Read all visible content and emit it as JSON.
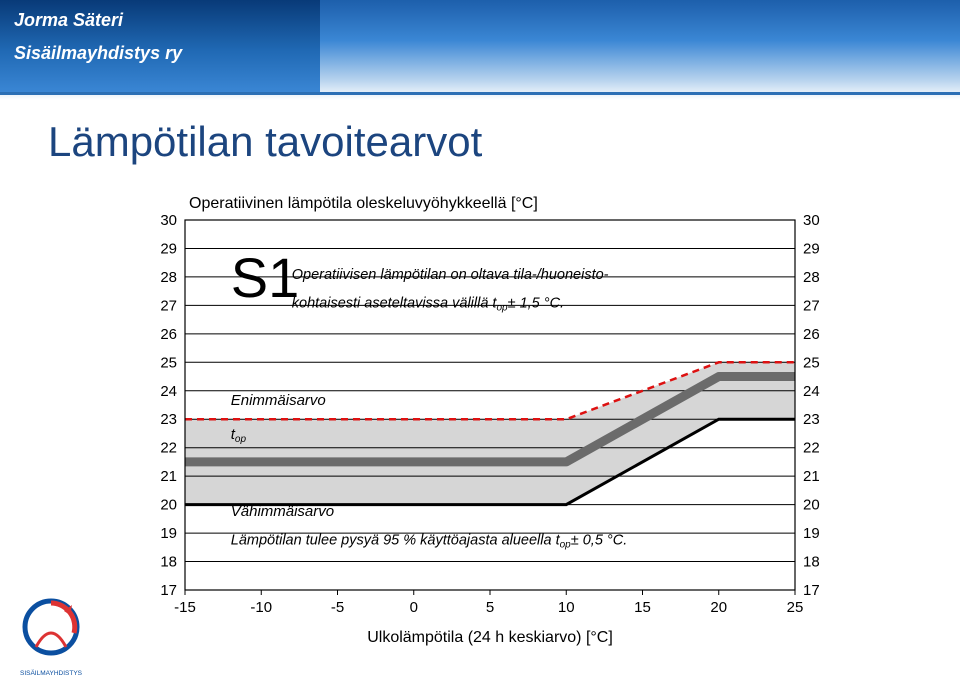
{
  "header": {
    "author": "Jorma Säteri",
    "org": "Sisäilmayhdistys ry"
  },
  "title": "Lämpötilan tavoitearvot",
  "logo_caption": "SISÄILMAYHDISTYS",
  "chart_data": {
    "type": "line",
    "title": "Operatiivinen lämpötila oleskeluvyöhykkeellä [°C]",
    "class_label": "S1",
    "note1a": "Operatiivisen lämpötilan on oltava tila-/huoneisto-",
    "note1b": "kohtaisesti aseteltavissa välillä t",
    "note1c": "± 1,5 °C.",
    "note_sub1": "op",
    "max_label": "Enimmäisarvo",
    "top_label": "t",
    "top_sub": "op",
    "min_label": "Vähimmäisarvo",
    "note2a": "Lämpötilan tulee pysyä 95 % käyttöajasta alueella t",
    "note2b": "± 0,5 °C.",
    "xlabel": "Ulkolämpötila (24 h keskiarvo) [°C]",
    "ylabel": "",
    "x_ticks": [
      -15,
      -10,
      -5,
      0,
      5,
      10,
      15,
      20,
      25
    ],
    "y_ticks": [
      17,
      18,
      19,
      20,
      21,
      22,
      23,
      24,
      25,
      26,
      27,
      28,
      29,
      30
    ],
    "xlim": [
      -15,
      25
    ],
    "ylim": [
      17,
      30
    ],
    "series": [
      {
        "name": "Enimmäisarvo",
        "style": "dashed-red",
        "x": [
          -15,
          10,
          20,
          25
        ],
        "y": [
          23,
          23,
          25,
          25
        ]
      },
      {
        "name": "t_op",
        "style": "solid-grey",
        "x": [
          -15,
          10,
          20,
          25
        ],
        "y": [
          21.5,
          21.5,
          24.5,
          24.5
        ]
      },
      {
        "name": "Vähimmäisarvo",
        "style": "solid-black",
        "x": [
          -15,
          10,
          20,
          25
        ],
        "y": [
          20,
          20,
          23,
          23
        ]
      }
    ]
  }
}
